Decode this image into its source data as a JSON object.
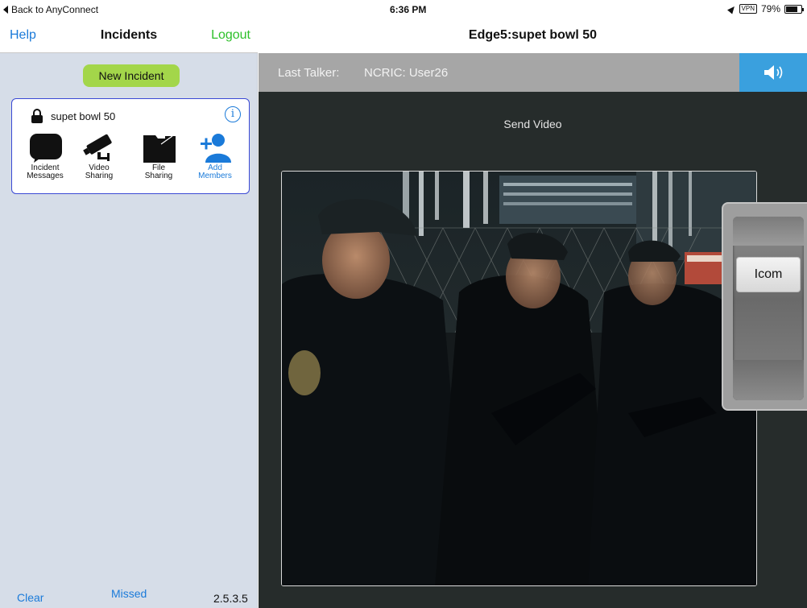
{
  "status_bar": {
    "back_label": "Back to AnyConnect",
    "time": "6:36 PM",
    "vpn": "VPN",
    "battery": "79%",
    "battery_level": 0.79
  },
  "left": {
    "nav": {
      "help": "Help",
      "title": "Incidents",
      "logout": "Logout"
    },
    "new_incident": "New Incident",
    "incident": {
      "name": "supet bowl 50",
      "info_icon": "info-icon",
      "tools": [
        {
          "line1": "Incident",
          "line2": "Messages",
          "icon": "message-bubble-icon"
        },
        {
          "line1": "Video",
          "line2": "Sharing",
          "icon": "security-camera-icon"
        },
        {
          "line1": "File",
          "line2": "Sharing",
          "icon": "folder-icon"
        },
        {
          "line1": "Add",
          "line2": "Members",
          "icon": "add-member-icon"
        }
      ]
    },
    "footer": {
      "clear": "Clear",
      "missed": "Missed",
      "version": "2.5.3.5"
    }
  },
  "right": {
    "title": "Edge5:supet bowl 50",
    "last_talker_label": "Last Talker:",
    "last_talker_value": "NCRIC: User26",
    "speaker_icon": "speaker-icon",
    "send_video": "Send Video",
    "icom_label": "Icom"
  },
  "colors": {
    "link_blue": "#1a7ad9",
    "logout_green": "#2ec02a",
    "new_incident_green": "#a3d64a",
    "card_border": "#3a49d4",
    "speaker_blue": "#3aa0de",
    "talker_bar": "#a6a6a6",
    "video_bg": "#262c2b"
  }
}
